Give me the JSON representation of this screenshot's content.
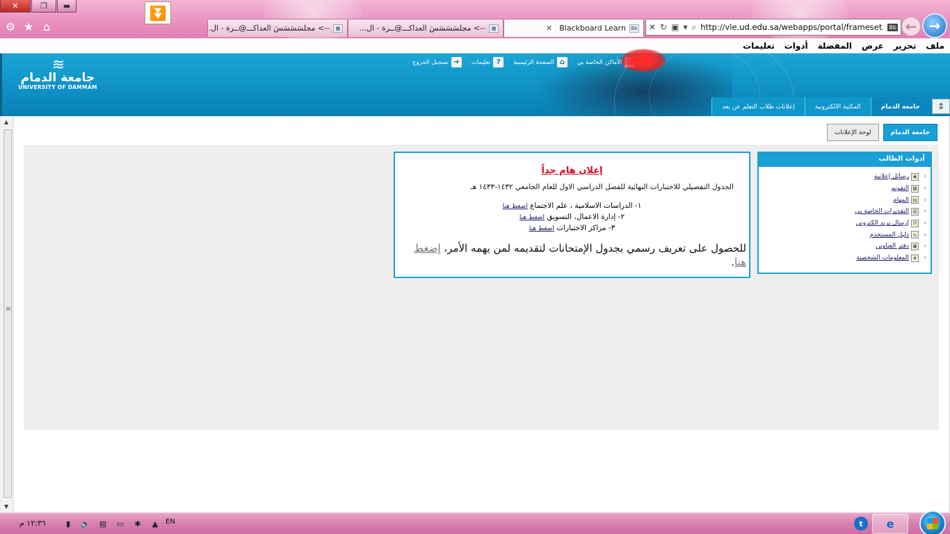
{
  "browser": {
    "window_controls": {
      "close": "✕",
      "maximize": "❐",
      "minimize": "▬"
    },
    "tabs": [
      {
        "label": "Blackboard Learn",
        "favicon": "Bb",
        "active": true
      },
      {
        "label": "--> مجلسَسَسَسَ العذاكـــ@ــرة - ال...",
        "favicon": "▦",
        "active": false
      },
      {
        "label": "--> مجلسَسَسَسَ العذاكـــ@ــرة - ال...",
        "favicon": "▦",
        "active": false
      }
    ],
    "address": {
      "url_prefix": "http://vle.",
      "url_domain": "ud.edu.sa",
      "url_suffix": "/webapps/portal/frameset.js",
      "badge": "Bb"
    },
    "menu": [
      "ملف",
      "تحرير",
      "عرض",
      "المفضلة",
      "أدوات",
      "تعليمات"
    ]
  },
  "header": {
    "logo": {
      "arabic": "جامعة الدمام",
      "english": "UNIVERSITY OF DAMMAM"
    },
    "top_links": [
      {
        "label": "الأماكن الخاصة بي",
        "icon": "home-people-icon",
        "glyph": "⌂"
      },
      {
        "label": "الصفحة الرئيسية",
        "icon": "home-icon",
        "glyph": "⌂"
      },
      {
        "label": "تعليمات",
        "icon": "help-icon",
        "glyph": "?"
      },
      {
        "label": "تسجيل الخروج",
        "icon": "logout-icon",
        "glyph": "➜"
      }
    ],
    "nav_tabs": [
      {
        "label": "جامعة الدمام",
        "active": true
      },
      {
        "label": "المكتبة الالكترونية",
        "active": false
      },
      {
        "label": "إعلانات طلاب التعلم عن بعد",
        "active": false
      }
    ]
  },
  "subtabs": [
    {
      "label": "جامعة الدمام",
      "active": true
    },
    {
      "label": "لوحة الإعلانات",
      "active": false
    }
  ],
  "student_tools": {
    "title": "أدوات الطالب",
    "items": [
      {
        "label": "رسائل إعلانية",
        "glyph": "◉"
      },
      {
        "label": "التقويم",
        "glyph": "▦"
      },
      {
        "label": "المهام",
        "glyph": "▤"
      },
      {
        "label": "التقديرات الخاصة بي",
        "glyph": "▥"
      },
      {
        "label": "إرسال بريد الكتروني",
        "glyph": "✉"
      },
      {
        "label": "دليل المستخدم",
        "glyph": "◎"
      },
      {
        "label": "دفتر العناوين",
        "glyph": "▣"
      },
      {
        "label": "المعلومات الشخصية",
        "glyph": "◈"
      }
    ]
  },
  "announcement": {
    "title": "إعلان هام جداً",
    "subtitle": "الجدول التفصيلي للاختبارات النهائية للفصل الدراسي الاول للعام الجامعي ١٤٣٢-١٤٣٣ هـ",
    "items": [
      {
        "text": "١- الدراسات الاسلامية ، علم الاجتماع ",
        "link": "اضغط هنا"
      },
      {
        "text": "٢- إدارة الاعمال، التسويق ",
        "link": "اضغط هنا"
      },
      {
        "text": "٣- مراكز الاختبارات ",
        "link": "اضغط هنا"
      }
    ],
    "footer_text": "للحصول على تعريف رسمي بجدول الإمتحانات لتقديمه لمن يهمه الأمر، ",
    "footer_link": "إضغط هنا",
    "footer_end": "."
  },
  "taskbar": {
    "clock": "١٢:٣٦ م",
    "lang": "EN"
  }
}
